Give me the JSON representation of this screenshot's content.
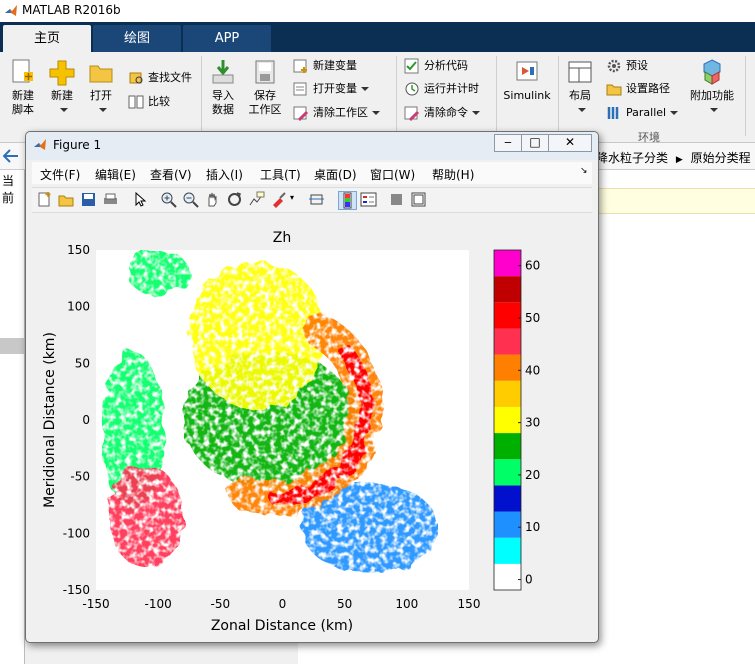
{
  "app": {
    "title": "MATLAB R2016b"
  },
  "tabs": [
    {
      "label": "主页",
      "active": true
    },
    {
      "label": "绘图",
      "active": false
    },
    {
      "label": "APP",
      "active": false
    }
  ],
  "ribbon": {
    "new_script": "新建\n脚本",
    "new": "新建",
    "open": "打开",
    "find_files": "查找文件",
    "compare": "比较",
    "import_data": "导入\n数据",
    "save_workspace": "保存\n工作区",
    "new_variable": "新建变量",
    "open_variable": "打开变量",
    "clear_workspace": "清除工作区",
    "analyze_code": "分析代码",
    "run_and_time": "运行并计时",
    "clear_commands": "清除命令",
    "simulink": "Simulink",
    "layout": "布局",
    "preferences": "预设",
    "set_path": "设置路径",
    "parallel": "Parallel",
    "addons": "附加功能",
    "environment_group": "环境"
  },
  "breadcrumb": {
    "segments": [
      "降水粒子分类",
      "原始分类程"
    ]
  },
  "left_pane_char": "当前",
  "figure": {
    "title": "Figure 1",
    "menus": [
      "文件(F)",
      "编辑(E)",
      "查看(V)",
      "插入(I)",
      "工具(T)",
      "桌面(D)",
      "窗口(W)",
      "帮助(H)"
    ],
    "toolbar_icons": [
      "new-figure-icon",
      "open-file-icon",
      "save-icon",
      "print-icon",
      "pointer-icon",
      "zoom-in-icon",
      "zoom-out-icon",
      "pan-icon",
      "rotate-icon",
      "data-cursor-icon",
      "brush-icon",
      "link-plot-icon",
      "colorbar-icon",
      "legend-icon",
      "hide-plot-tools-icon",
      "show-plot-tools-icon"
    ]
  },
  "chart_data": {
    "type": "heatmap",
    "title": "Zh",
    "xlabel": "Zonal Distance (km)",
    "ylabel": "Meridional Distance (km)",
    "xlim": [
      -150,
      150
    ],
    "ylim": [
      -150,
      150
    ],
    "xticks": [
      "-150",
      "-100",
      "-50",
      "0",
      "50",
      "100",
      "150"
    ],
    "yticks": [
      "150",
      "100",
      "50",
      "0",
      "-50",
      "-100",
      "-150"
    ],
    "colorbar": {
      "range": [
        -2,
        63
      ],
      "ticks": [
        "0",
        "10",
        "20",
        "30",
        "40",
        "50",
        "60"
      ],
      "levels": [
        {
          "from": -2,
          "to": 3,
          "color": "#ffffff"
        },
        {
          "from": 3,
          "to": 8,
          "color": "#00ffff"
        },
        {
          "from": 8,
          "to": 13,
          "color": "#1e90ff"
        },
        {
          "from": 13,
          "to": 18,
          "color": "#0010cc"
        },
        {
          "from": 18,
          "to": 23,
          "color": "#00ff66"
        },
        {
          "from": 23,
          "to": 28,
          "color": "#00b000"
        },
        {
          "from": 28,
          "to": 33,
          "color": "#ffff00"
        },
        {
          "from": 33,
          "to": 38,
          "color": "#ffcc00"
        },
        {
          "from": 38,
          "to": 43,
          "color": "#ff7f00"
        },
        {
          "from": 43,
          "to": 48,
          "color": "#ff3050"
        },
        {
          "from": 48,
          "to": 53,
          "color": "#ff0000"
        },
        {
          "from": 53,
          "to": 58,
          "color": "#c00000"
        },
        {
          "from": 58,
          "to": 63,
          "color": "#ff00cc"
        },
        {
          "from": 63,
          "to": 68,
          "color": "#9933cc"
        }
      ]
    },
    "field_regions": [
      {
        "label": "eastern arc band",
        "shape": "arc",
        "cx": -5,
        "cy": 10,
        "r_km": 72,
        "thickness_km": 28,
        "from_deg": -110,
        "to_deg": 60,
        "dbz": 40
      },
      {
        "label": "eastern arc core",
        "shape": "arc",
        "cx": -5,
        "cy": 10,
        "r_km": 72,
        "thickness_km": 12,
        "from_deg": -90,
        "to_deg": 40,
        "dbz": 50
      },
      {
        "label": "northern plume",
        "shape": "ellipse",
        "cx": -20,
        "cy": 75,
        "rx": 55,
        "ry": 65,
        "dbz": 30
      },
      {
        "label": "central area",
        "shape": "ellipse",
        "cx": -10,
        "cy": 0,
        "rx": 70,
        "ry": 60,
        "dbz": 25
      },
      {
        "label": "southwest core",
        "shape": "ellipse",
        "cx": -110,
        "cy": -85,
        "rx": 30,
        "ry": 45,
        "dbz": 45
      },
      {
        "label": "western fringe",
        "shape": "ellipse",
        "cx": -120,
        "cy": -10,
        "rx": 25,
        "ry": 70,
        "dbz": 22
      },
      {
        "label": "southeast spray",
        "shape": "ellipse",
        "cx": 70,
        "cy": -95,
        "rx": 55,
        "ry": 40,
        "dbz": 12
      },
      {
        "label": "northwest fringe",
        "shape": "ellipse",
        "cx": -100,
        "cy": 130,
        "rx": 25,
        "ry": 20,
        "dbz": 18
      }
    ]
  },
  "colors": {
    "tabbar": "#0b2e53",
    "tab_inactive": "#1a4777",
    "figure_title": "#e6ecf3"
  }
}
